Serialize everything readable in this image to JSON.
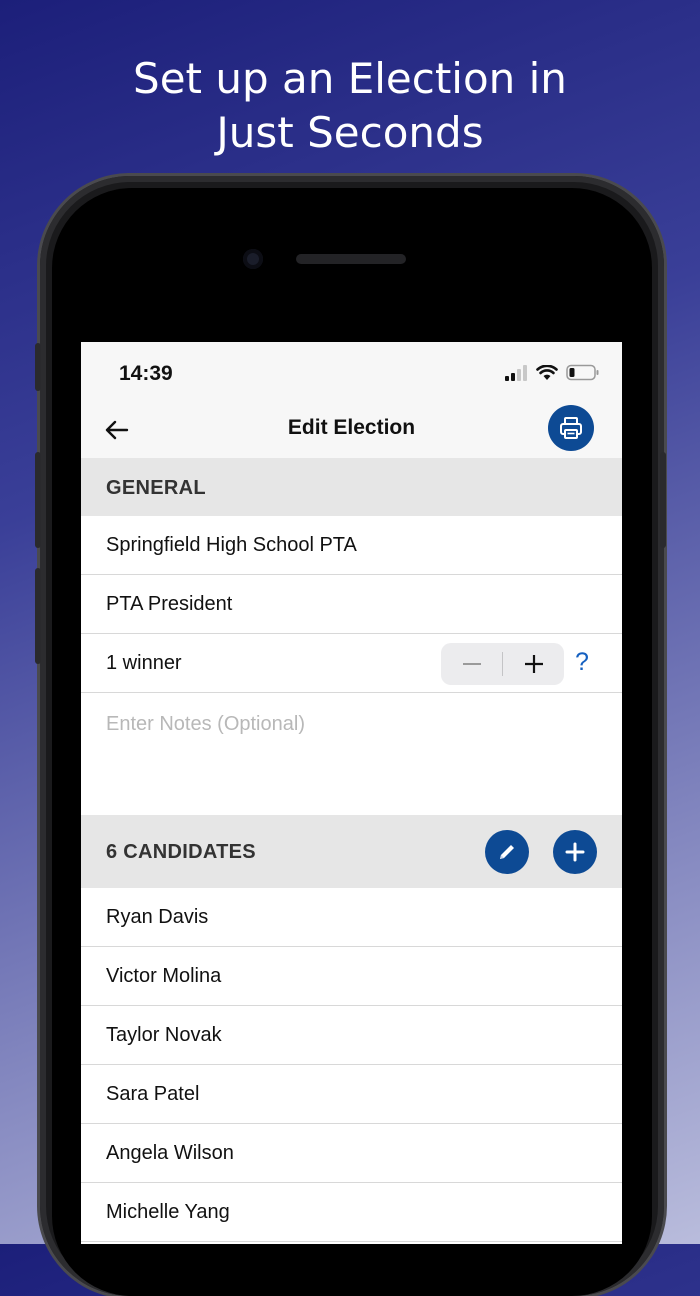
{
  "headline": {
    "line1": "Set up an Election in",
    "line2": "Just Seconds"
  },
  "status_bar": {
    "time": "14:39"
  },
  "nav": {
    "title": "Edit Election",
    "back_icon": "arrow-left-icon",
    "print_icon": "printer-icon"
  },
  "general": {
    "header": "GENERAL",
    "organization": "Springfield High School PTA",
    "position": "PTA President",
    "winners_label": "1 winner",
    "stepper_minus": "−",
    "stepper_plus": "+",
    "help": "?",
    "notes_placeholder": "Enter Notes (Optional)"
  },
  "candidates": {
    "header": "6 CANDIDATES",
    "edit_icon": "pencil-icon",
    "add_icon": "plus-icon",
    "items": [
      {
        "name": "Ryan Davis"
      },
      {
        "name": "Victor Molina"
      },
      {
        "name": "Taylor Novak"
      },
      {
        "name": "Sara Patel"
      },
      {
        "name": "Angela Wilson"
      },
      {
        "name": "Michelle Yang"
      }
    ]
  },
  "colors": {
    "accent": "#0d4a94",
    "link": "#1560c0",
    "section_bg": "#e6e6e6"
  }
}
